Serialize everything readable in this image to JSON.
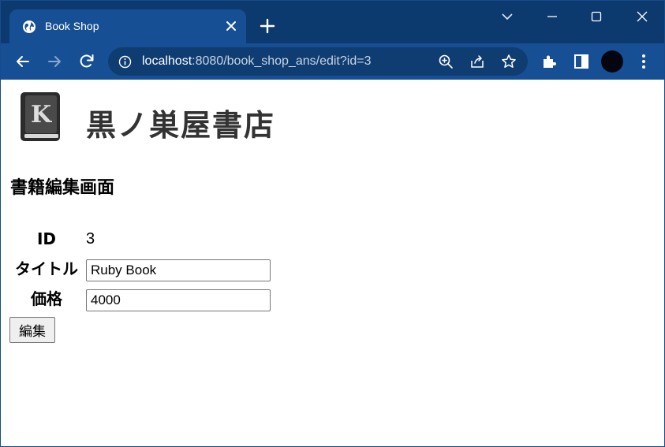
{
  "browser": {
    "tab": {
      "title": "Book Shop",
      "favicon": "globe-icon"
    },
    "url": {
      "host": "localhost",
      "rest": ":8080/book_shop_ans/edit?id=3"
    },
    "colors": {
      "tabstrip": "#0d3a6e",
      "active_tab": "#174f94",
      "toolbar": "#174f94",
      "omnibox": "#0f3d72"
    }
  },
  "page": {
    "logo": {
      "text": "黒ノ巣屋書店",
      "letter": "K"
    },
    "heading": "書籍編集画面",
    "form": {
      "id_label": "ID",
      "id_value": "3",
      "title_label": "タイトル",
      "title_value": "Ruby Book",
      "price_label": "価格",
      "price_value": "4000",
      "submit_label": "編集"
    }
  }
}
